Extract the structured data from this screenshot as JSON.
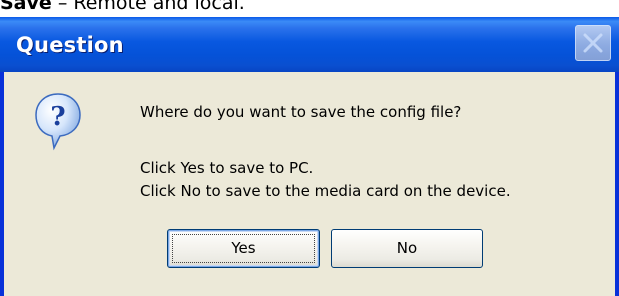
{
  "page_caption": {
    "bold_text": "Save",
    "rest_text": " – Remote and local."
  },
  "dialog": {
    "title": "Question",
    "icon": "question-icon",
    "message_question": "Where do you want to save the config file?",
    "message_line1": "Click Yes to save to PC.",
    "message_line2": "Click No to save to the media card on the device.",
    "buttons": {
      "yes_label": "Yes",
      "no_label": "No"
    },
    "close_icon": "close-icon"
  },
  "colors": {
    "titlebar": "#0552d8",
    "dialog_bg": "#ece9d8",
    "border": "#0831d9"
  }
}
